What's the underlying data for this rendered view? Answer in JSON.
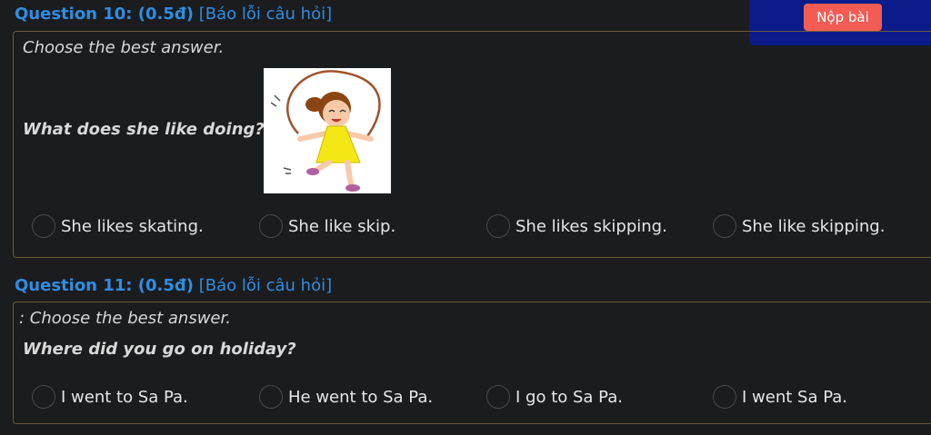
{
  "submit": {
    "label": "Nộp bài"
  },
  "questions": [
    {
      "number_label": "Question 10: (0.5đ)",
      "report_label": "[Báo lỗi câu hỏi]",
      "instruction": "Choose the best answer.",
      "prompt": "What does she like doing?",
      "picture_icon": "girl-skipping-rope-icon",
      "options": [
        "She likes skating.",
        "She like skip.",
        "She likes skipping.",
        "She like skipping."
      ]
    },
    {
      "number_label": "Question 11: (0.5đ)",
      "report_label": "[Báo lỗi câu hỏi]",
      "instruction": ": Choose the best answer.",
      "prompt": "Where did you go on holiday?",
      "options": [
        "I went to Sa Pa.",
        "He went to Sa Pa.",
        "I go to Sa Pa.",
        "I went Sa Pa."
      ]
    }
  ],
  "colors": {
    "background": "#1b1c1e",
    "header_blue": "#2f8de4",
    "submit_button": "#f25c54",
    "submit_panel": "#0b1c8a",
    "box_border": "#6a5a3a"
  }
}
